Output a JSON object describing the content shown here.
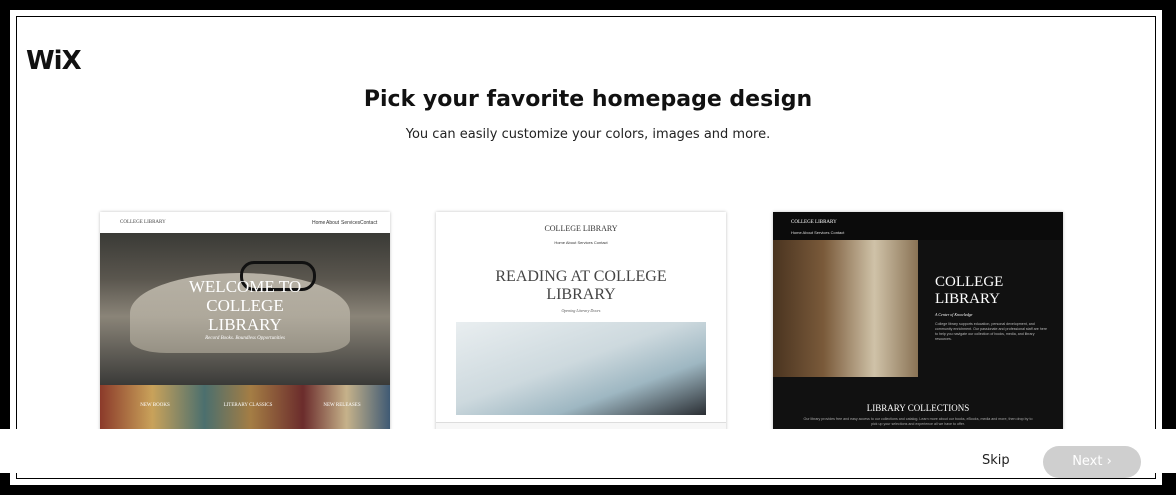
{
  "header": {
    "logo": "WiX",
    "title": "Pick your favorite homepage design",
    "subtitle": "You can easily customize your colors, images and more."
  },
  "cards": [
    {
      "brand": "COLLEGE LIBRARY",
      "nav": [
        "Home",
        "About",
        "Services",
        "Contact"
      ],
      "heading": "WELCOME TO COLLEGE LIBRARY",
      "tagline": "Record Books. Boundless Opportunities",
      "strip": [
        "NEW BOOKS",
        "LITERARY CLASSICS",
        "NEW RELEASES"
      ]
    },
    {
      "brand": "COLLEGE LIBRARY",
      "nav": "Home  About  Services  Contact",
      "heading": "READING AT COLLEGE LIBRARY",
      "tagline": "Opening Literary Doors"
    },
    {
      "brand": "COLLEGE LIBRARY",
      "nav": "Home  About  Services  Contact",
      "heading": "COLLEGE LIBRARY",
      "tagline": "A Center of Knowledge",
      "body": "College library supports education, personal development, and community enrichment. Our passionate and professional staff are here to help you navigate our collection of books, media, and library resources.",
      "collections_title": "LIBRARY COLLECTIONS",
      "collections_text": "Our library provides free and easy access to our collections and catalog. Learn more about our books, eBooks, media and more, then drop by to pick up your selections and experience all we have to offer."
    }
  ],
  "footer": {
    "skip_label": "Skip",
    "next_label": "Next ›"
  },
  "colors": {
    "next_disabled": "#cfcfcf",
    "card3_bg": "#111111"
  }
}
